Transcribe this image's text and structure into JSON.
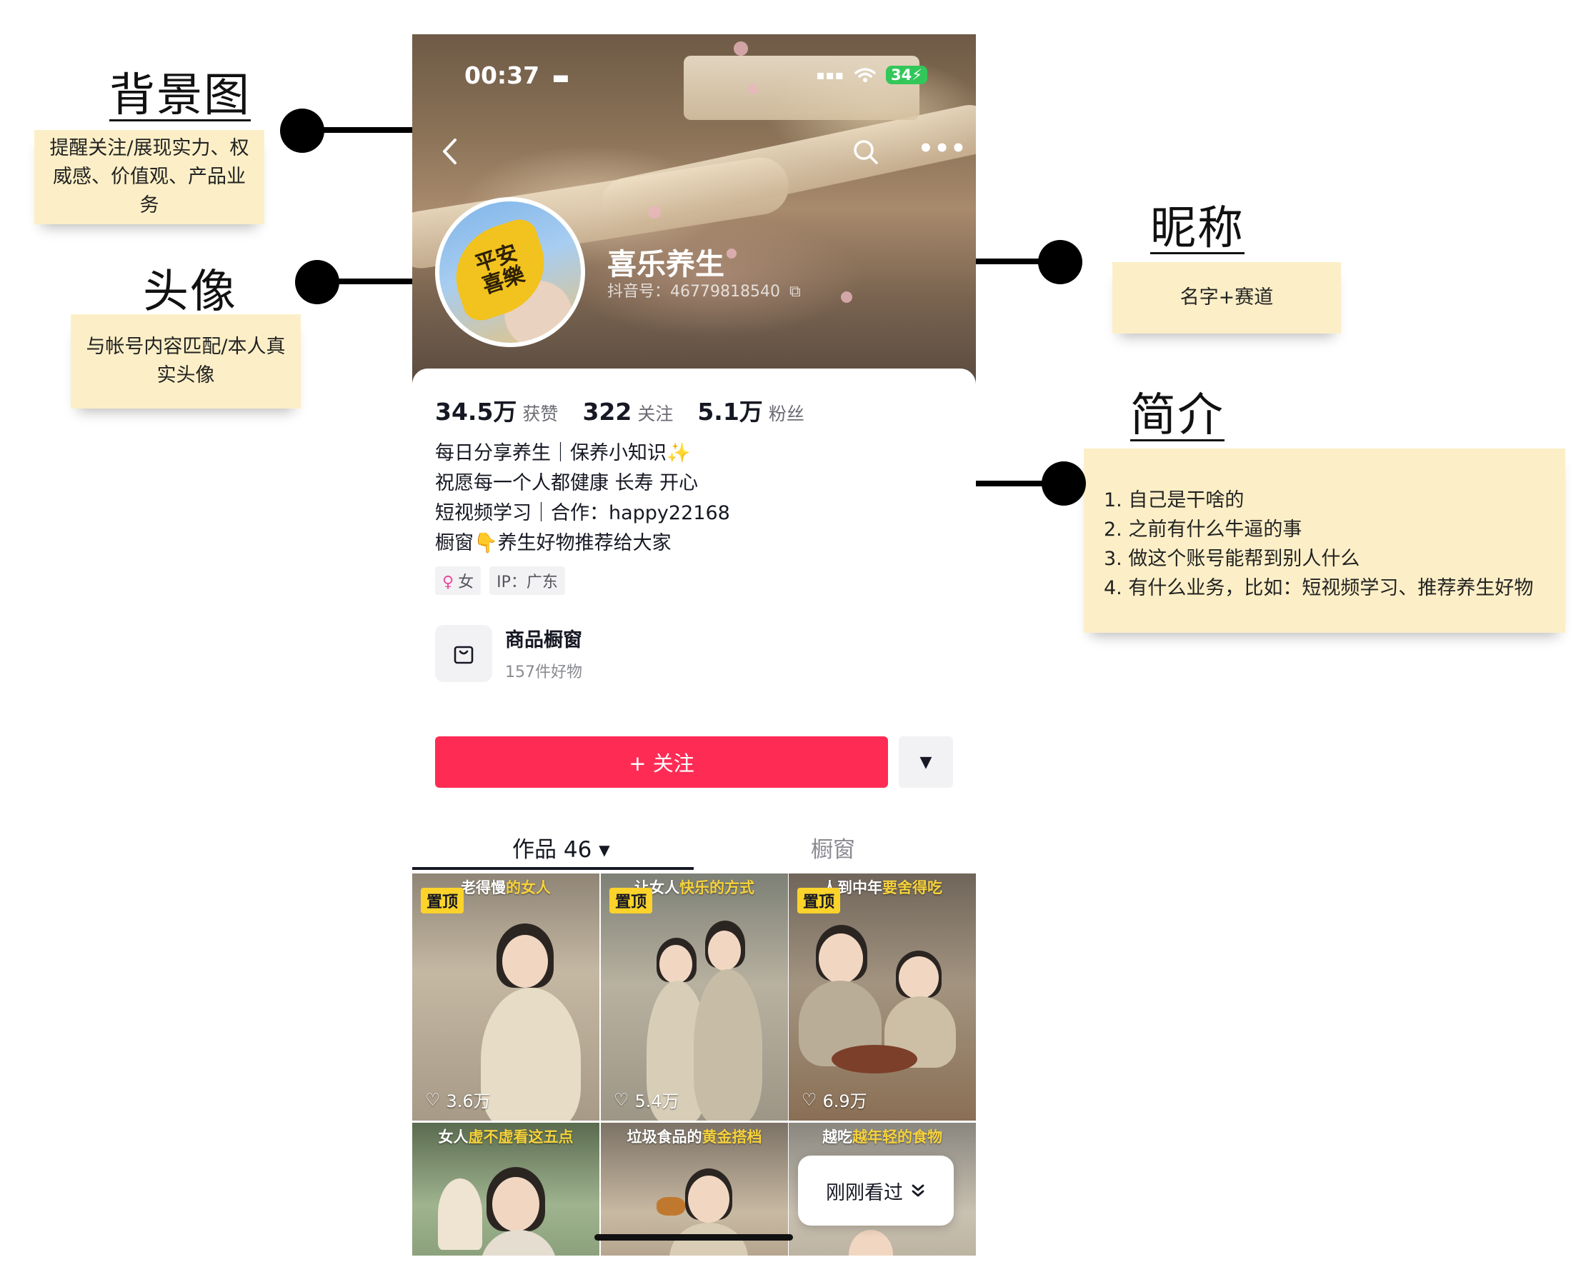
{
  "annotations": {
    "background": {
      "title": "背景图",
      "note_lines": [
        "提醒关注/展现实力、权",
        "威感、价值观、产品业务"
      ]
    },
    "avatar": {
      "title": "头像",
      "note_lines": [
        "与帐号内容匹配/本人真",
        "实头像"
      ]
    },
    "nickname": {
      "title": "昵称",
      "note": "名字+赛道"
    },
    "bio": {
      "title": "简介",
      "items": [
        "1. 自己是干啥的",
        "2. 之前有什么牛逼的事",
        "3. 做这个账号能帮到别人什么",
        "4. 有什么业务，比如：短视频学习、推荐养生好物"
      ]
    }
  },
  "status_bar": {
    "time": "00:37",
    "battery": "34"
  },
  "profile": {
    "avatar_text_top": "平安",
    "avatar_text_bottom": "喜樂",
    "nickname": "喜乐养生",
    "douyin_id": "抖音号：46779818540",
    "stats": [
      {
        "value": "34.5万",
        "label": "获赞"
      },
      {
        "value": "322",
        "label": "关注"
      },
      {
        "value": "5.1万",
        "label": "粉丝"
      }
    ],
    "bio_lines": [
      "每日分享养生｜保养小知识✨",
      "祝愿每一个人都健康 长寿 开心",
      "短视频学习｜合作：happy22168",
      "橱窗👇养生好物推荐给大家"
    ],
    "tags": [
      {
        "symbol": "♀",
        "text": "女"
      },
      {
        "text": "IP：广东"
      }
    ],
    "shop": {
      "title": "商品橱窗",
      "subtitle": "157件好物"
    },
    "follow_label": "+ 关注"
  },
  "tabs": [
    {
      "label": "作品 46 ▾"
    },
    {
      "label": "橱窗"
    }
  ],
  "videos": [
    {
      "caption_a": "老得慢",
      "caption_b": "的女人",
      "pin": "置顶",
      "likes": "3.6万"
    },
    {
      "caption_a": "让女人",
      "caption_b": "快乐的方式",
      "pin": "置顶",
      "likes": "5.4万"
    },
    {
      "caption_a": "人到中年",
      "caption_b": "要舍得吃",
      "pin": "置顶",
      "likes": "6.9万"
    },
    {
      "caption_a": "女人",
      "caption_b": "虚不虚看这五点"
    },
    {
      "caption_a": "垃圾食品的",
      "caption_b": "黄金搭档"
    },
    {
      "caption_a": "越吃",
      "caption_b": "越年轻的食物"
    }
  ],
  "recently_viewed": "刚刚看过",
  "colors": {
    "accent": "#fe2c55",
    "sticky": "#fcefc7",
    "pin": "#fcd32a"
  }
}
